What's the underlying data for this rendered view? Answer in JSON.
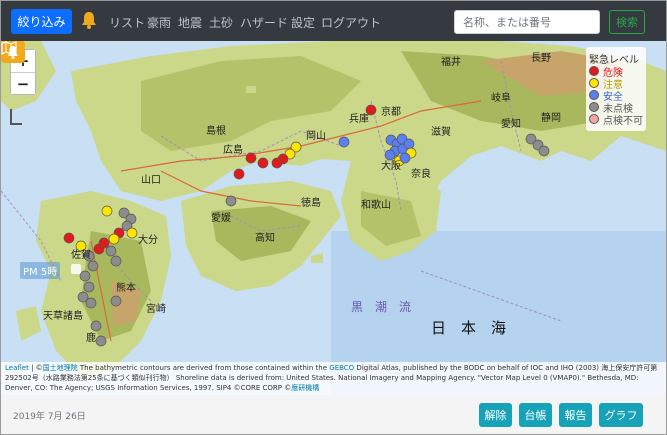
{
  "navbar": {
    "filter_label": "絞り込み",
    "icon": "bell-icon",
    "links": [
      "リスト",
      "豪雨",
      "地震",
      "土砂",
      "ハザード",
      "設定",
      "ログアウト"
    ],
    "search_placeholder": "名称、または番号",
    "search_value": "",
    "search_label": "検索"
  },
  "map": {
    "zoom_in": "+",
    "zoom_out": "−",
    "time_label": "PM 5時",
    "legend": {
      "title": "緊急レベル",
      "items": [
        {
          "label": "危険",
          "color": "#e31a1c"
        },
        {
          "label": "注意",
          "color": "#ffe600"
        },
        {
          "label": "安全",
          "color": "#5b7ff0"
        },
        {
          "label": "未点検",
          "color": "#8c8c8c"
        },
        {
          "label": "点検不可",
          "color": "#f2a7a7"
        }
      ]
    },
    "place_labels": [
      "福井",
      "長野",
      "岐阜",
      "愛知",
      "静岡",
      "兵庫",
      "京都",
      "滋賀",
      "奈良",
      "大阪",
      "和歌山",
      "岡山",
      "島根",
      "広島",
      "山口",
      "徳島",
      "高知",
      "愛媛",
      "大分",
      "熊本",
      "佐賀",
      "宮崎",
      "鹿",
      "天草諸島"
    ],
    "sea_label": "日　本　海",
    "current_label": "黒　潮　流",
    "attribution": {
      "leaflet": "Leaflet",
      "gsi": "国土地理院",
      "text1": " The bathymetric contours are derived from those contained within the ",
      "gebco": "GEBCO",
      "text2": " Digital Atlas, published by the BODC on behalf of IOC and IHO (2003) 海上保安庁許可第292502号（水路業務法第25条に基づく類似刊行物） Shoreline data is derived from: United States. National Imagery and Mapping Agency. \"Vector Map Level 0 (VMAP0).\" Bethesda, MD: Denver, CO: The Agency; USGS Information Services, 1997. SIP4 ©CORE CORP ©",
      "company": "應研機構"
    }
  },
  "footer": {
    "date": "2019年 7月 26日",
    "buttons": [
      "解除",
      "台帳",
      "報告",
      "グラフ"
    ]
  }
}
